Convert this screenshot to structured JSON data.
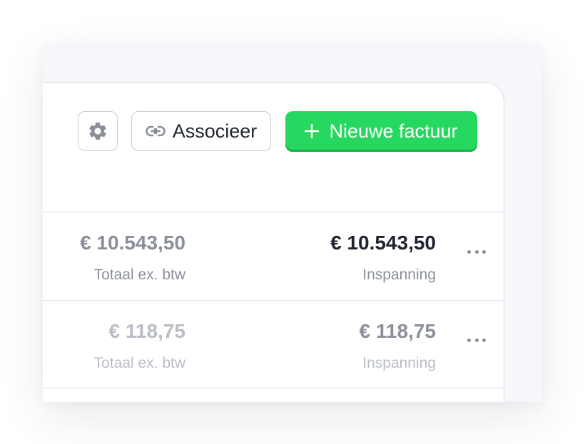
{
  "toolbar": {
    "settings_icon": "gear-icon",
    "associate_icon": "link-icon",
    "associate_label": "Associeer",
    "new_invoice_icon": "plus-icon",
    "new_invoice_label": "Nieuwe factuur",
    "new_invoice_color": "#26d85f"
  },
  "rows": [
    {
      "total_ex_vat": "€ 10.543,50",
      "total_ex_vat_label": "Totaal ex. btw",
      "effort": "€ 10.543,50",
      "effort_label": "Inspanning",
      "menu_icon": "more-horizontal-icon"
    },
    {
      "total_ex_vat": "€ 118,75",
      "total_ex_vat_label": "Totaal ex. btw",
      "effort": "€ 118,75",
      "effort_label": "Inspanning",
      "menu_icon": "more-horizontal-icon"
    }
  ]
}
